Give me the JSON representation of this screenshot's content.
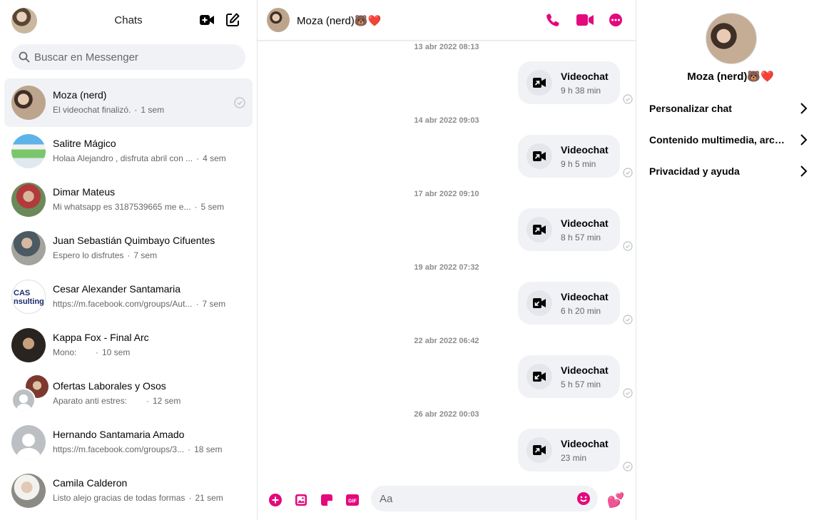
{
  "sidebar": {
    "title": "Chats",
    "search_placeholder": "Buscar en Messenger",
    "chats": [
      {
        "name": "Moza (nerd)",
        "preview": "El videochat finalizó.",
        "time": "1 sem",
        "active": true
      },
      {
        "name": "Salitre Mágico",
        "preview": "Holaa Alejandro , disfruta abril con ...",
        "time": "4 sem"
      },
      {
        "name": "Dimar Mateus",
        "preview": "Mi whatsapp es 3187539665 me e...",
        "time": "5 sem"
      },
      {
        "name": "Juan Sebastián Quimbayo Cifuentes",
        "preview": "Espero lo disfrutes",
        "time": "7 sem"
      },
      {
        "name": "Cesar Alexander Santamaria",
        "preview": "https://m.facebook.com/groups/Aut...",
        "time": "7 sem"
      },
      {
        "name": "Kappa Fox - Final Arc",
        "preview": "Mono:",
        "time": "10 sem"
      },
      {
        "name": "Ofertas Laborales y Osos",
        "preview": "Aparato anti estres:",
        "time": "12 sem"
      },
      {
        "name": "Hernando Santamaria Amado",
        "preview": "https://m.facebook.com/groups/3...",
        "time": "18 sem"
      },
      {
        "name": "Camila Calderon",
        "preview": "Listo alejo gracias de todas formas",
        "time": "21 sem"
      }
    ],
    "cas_logo_text": "CAS nsulting"
  },
  "conversation": {
    "contact_name": "Moza (nerd)🐻❤️",
    "messages": [
      {
        "date": "13 abr 2022 08:13",
        "title": "Videochat",
        "duration": "9 h 38 min"
      },
      {
        "date": "14 abr 2022 09:03",
        "title": "Videochat",
        "duration": "9 h 5 min"
      },
      {
        "date": "17 abr 2022 09:10",
        "title": "Videochat",
        "duration": "8 h 57 min"
      },
      {
        "date": "19 abr 2022 07:32",
        "title": "Videochat",
        "duration": "6 h 20 min"
      },
      {
        "date": "22 abr 2022 06:42",
        "title": "Videochat",
        "duration": "5 h 57 min"
      },
      {
        "date": "26 abr 2022 00:03",
        "title": "Videochat",
        "duration": "23 min"
      }
    ],
    "composer_placeholder": "Aa",
    "reaction_emoji": "💕"
  },
  "info": {
    "name": "Moza (nerd)🐻❤️",
    "rows": [
      {
        "label": "Personalizar chat"
      },
      {
        "label": "Contenido multimedia, archivos y enlaces"
      },
      {
        "label": "Privacidad y ayuda"
      }
    ]
  },
  "colors": {
    "accent": "#e4097d",
    "muted": "#65676b",
    "bubble": "#f0f2f5"
  },
  "icons": [
    "new-video-room-icon",
    "compose-icon",
    "search-icon",
    "phone-icon",
    "video-camera-icon",
    "more-icon",
    "plus-icon",
    "image-icon",
    "sticker-icon",
    "gif-icon",
    "emoji-icon",
    "chevron-right-icon"
  ]
}
